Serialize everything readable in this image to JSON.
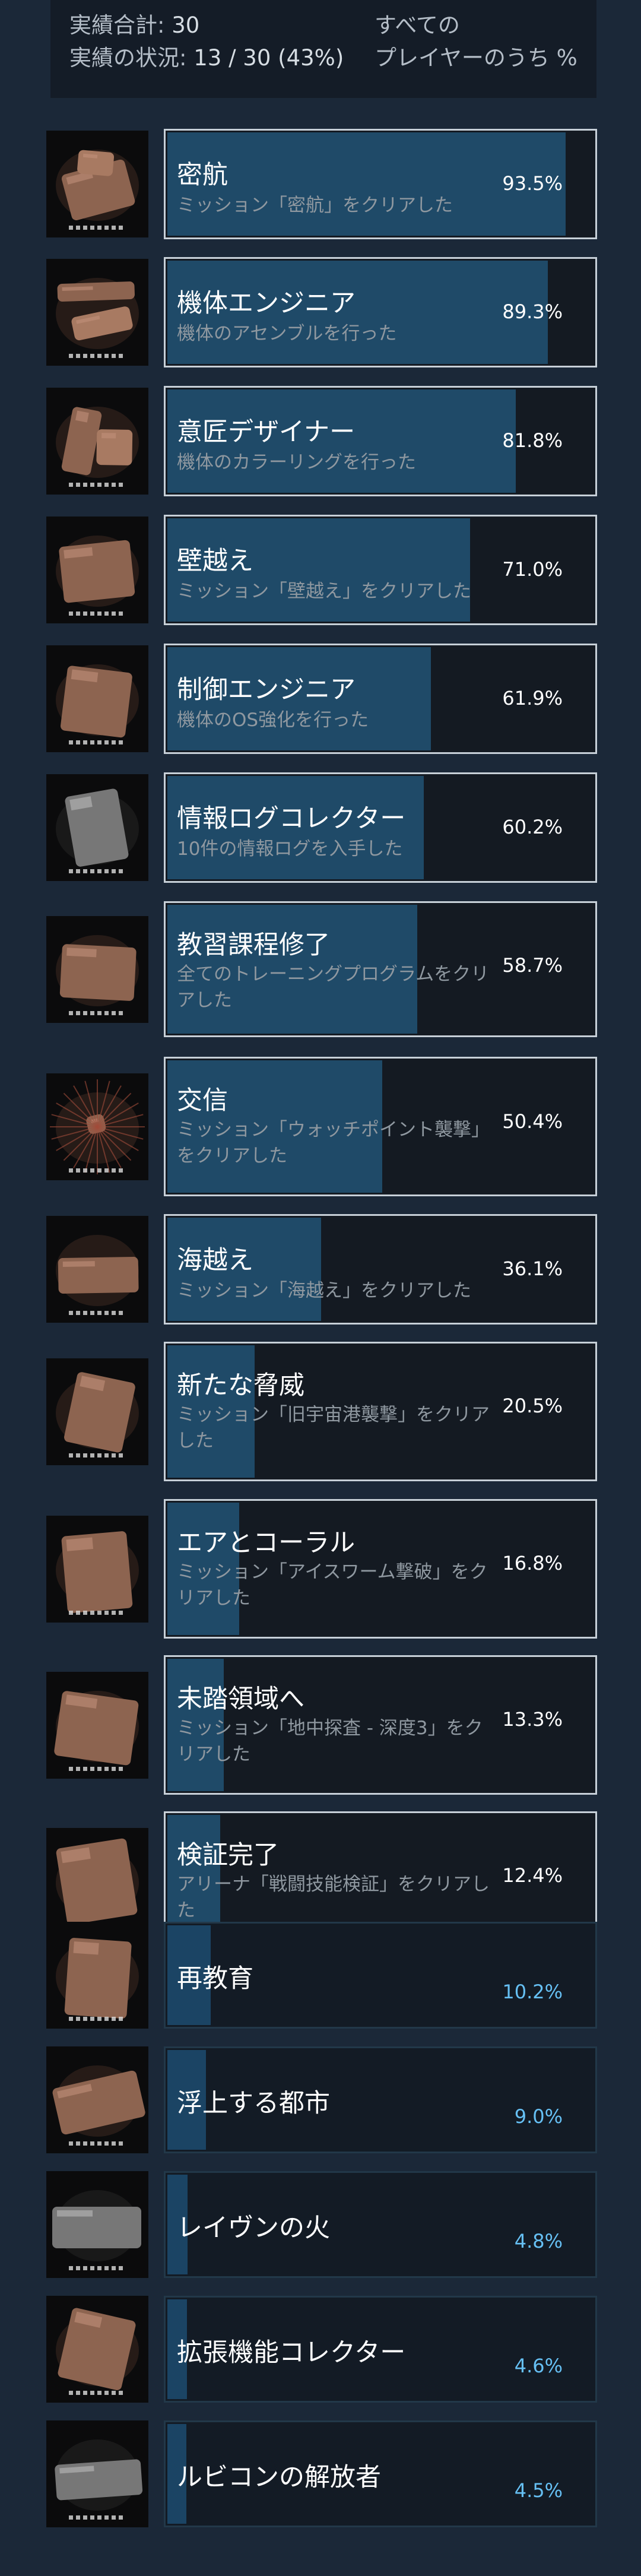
{
  "header": {
    "total_label": "実績合計:",
    "total_value": "30",
    "status_label": "実績の状況:",
    "status_value": "13 / 30 (43%)",
    "right_line1": "すべての",
    "right_line2": "プレイヤーのうち %"
  },
  "achievements": [
    {
      "title": "密航",
      "desc": "ミッション「密航」をクリアした",
      "percent": "93.5%",
      "fraction": 0.935,
      "unlocked": true,
      "icon": "stowaway-icon"
    },
    {
      "title": "機体エンジニア",
      "desc": "機体のアセンブルを行った",
      "percent": "89.3%",
      "fraction": 0.893,
      "unlocked": true,
      "icon": "wrench-icon"
    },
    {
      "title": "意匠デザイナー",
      "desc": "機体のカラーリングを行った",
      "percent": "81.8%",
      "fraction": 0.818,
      "unlocked": true,
      "icon": "paint-icon"
    },
    {
      "title": "壁越え",
      "desc": "ミッション「壁越え」をクリアした",
      "percent": "71.0%",
      "fraction": 0.71,
      "unlocked": true,
      "icon": "wall-icon"
    },
    {
      "title": "制御エンジニア",
      "desc": "機体のOS強化を行った",
      "percent": "61.9%",
      "fraction": 0.619,
      "unlocked": true,
      "icon": "chip-icon"
    },
    {
      "title": "情報ログコレクター",
      "desc": "10件の情報ログを入手した",
      "percent": "60.2%",
      "fraction": 0.602,
      "unlocked": true,
      "icon": "data-log-icon"
    },
    {
      "title": "教習課程修了",
      "desc": "全てのトレーニングプログラムをクリアした",
      "percent": "58.7%",
      "fraction": 0.587,
      "unlocked": true,
      "icon": "training-icon"
    },
    {
      "title": "交信",
      "desc": "ミッション「ウォッチポイント襲撃」をクリアした",
      "percent": "50.4%",
      "fraction": 0.504,
      "unlocked": true,
      "icon": "signal-icon"
    },
    {
      "title": "海越え",
      "desc": "ミッション「海越え」をクリアした",
      "percent": "36.1%",
      "fraction": 0.361,
      "unlocked": true,
      "icon": "ship-icon"
    },
    {
      "title": "新たな脅威",
      "desc": "ミッション「旧宇宙港襲撃」をクリアした",
      "percent": "20.5%",
      "fraction": 0.205,
      "unlocked": true,
      "icon": "mech-icon"
    },
    {
      "title": "エアとコーラル",
      "desc": "ミッション「アイスワーム撃破」をクリアした",
      "percent": "16.8%",
      "fraction": 0.168,
      "unlocked": true,
      "icon": "flame-icon"
    },
    {
      "title": "未踏領域へ",
      "desc": "ミッション「地中探査 - 深度3」をクリアした",
      "percent": "13.3%",
      "fraction": 0.133,
      "unlocked": true,
      "icon": "excavation-icon"
    },
    {
      "title": "検証完了",
      "desc": "アリーナ「戦闘技能検証」をクリアした",
      "percent": "12.4%",
      "fraction": 0.124,
      "unlocked": true,
      "icon": "arena-icon"
    },
    {
      "title": "再教育",
      "desc": "",
      "percent": "10.2%",
      "fraction": 0.102,
      "unlocked": false,
      "icon": "reeducation-icon"
    },
    {
      "title": "浮上する都市",
      "desc": "",
      "percent": "9.0%",
      "fraction": 0.09,
      "unlocked": false,
      "icon": "city-icon"
    },
    {
      "title": "レイヴンの火",
      "desc": "",
      "percent": "4.8%",
      "fraction": 0.048,
      "unlocked": false,
      "icon": "fire-icon"
    },
    {
      "title": "拡張機能コレクター",
      "desc": "",
      "percent": "4.6%",
      "fraction": 0.046,
      "unlocked": false,
      "icon": "expansion-icon"
    },
    {
      "title": "ルビコンの解放者",
      "desc": "",
      "percent": "4.5%",
      "fraction": 0.045,
      "unlocked": false,
      "icon": "liberator-icon"
    }
  ]
}
